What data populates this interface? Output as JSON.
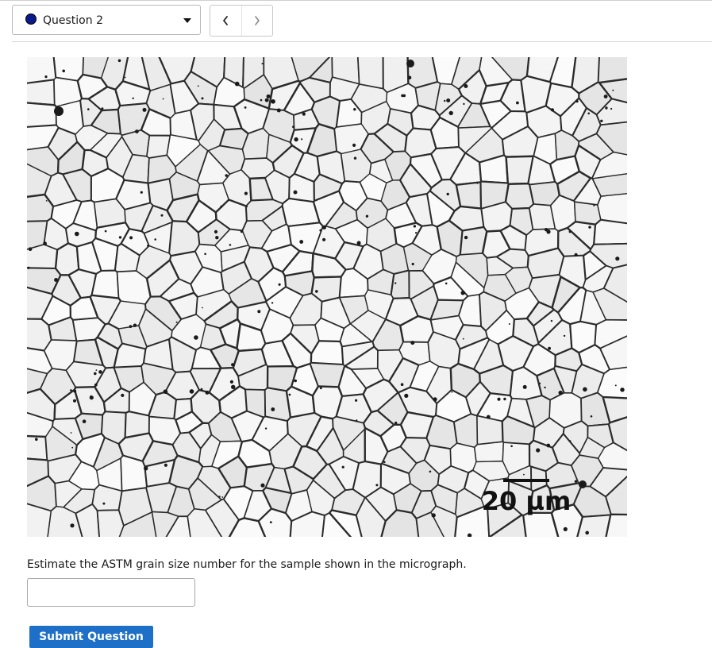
{
  "header": {
    "question_select": {
      "label": "Question 2",
      "status_color": "#0a1a8a"
    },
    "nav": {
      "prev_icon": "chevron-left-icon",
      "next_icon": "chevron-right-icon"
    }
  },
  "micrograph": {
    "scale_bar_label": "20 µm",
    "background_color": "#d9d9d9",
    "boundary_color": "#2b2b2b"
  },
  "question": {
    "prompt": "Estimate the ASTM grain size number for the sample shown in the micrograph.",
    "answer_value": "",
    "answer_placeholder": ""
  },
  "actions": {
    "submit_label": "Submit Question",
    "submit_color": "#1e6fc8"
  }
}
